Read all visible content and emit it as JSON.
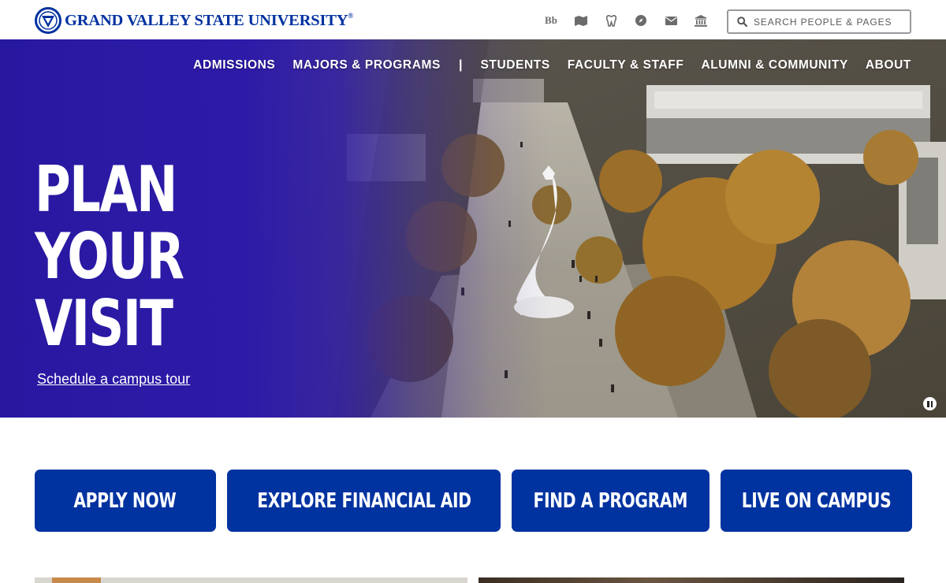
{
  "header": {
    "logo_text": "GRAND VALLEY STATE UNIVERSITY",
    "logo_tm": "®",
    "utility_icons": [
      {
        "name": "blackboard-icon",
        "glyph": "Bb"
      },
      {
        "name": "map-icon"
      },
      {
        "name": "tooth-icon"
      },
      {
        "name": "compass-icon"
      },
      {
        "name": "mail-icon"
      },
      {
        "name": "institution-icon"
      }
    ],
    "search_placeholder": "SEARCH PEOPLE & PAGES"
  },
  "nav": {
    "items": [
      "ADMISSIONS",
      "MAJORS & PROGRAMS",
      "STUDENTS",
      "FACULTY & STAFF",
      "ALUMNI & COMMUNITY",
      "ABOUT"
    ],
    "separator": "|"
  },
  "hero": {
    "headline_lines": [
      "PLAN",
      "YOUR",
      "VISIT"
    ],
    "link_text": "Schedule a campus tour"
  },
  "cta_buttons": [
    "APPLY NOW",
    "EXPLORE FINANCIAL AID",
    "FIND A PROGRAM",
    "LIVE ON CAMPUS"
  ],
  "colors": {
    "brand_blue": "#0032a0",
    "hero_overlay": "#2818a0",
    "white": "#ffffff"
  }
}
